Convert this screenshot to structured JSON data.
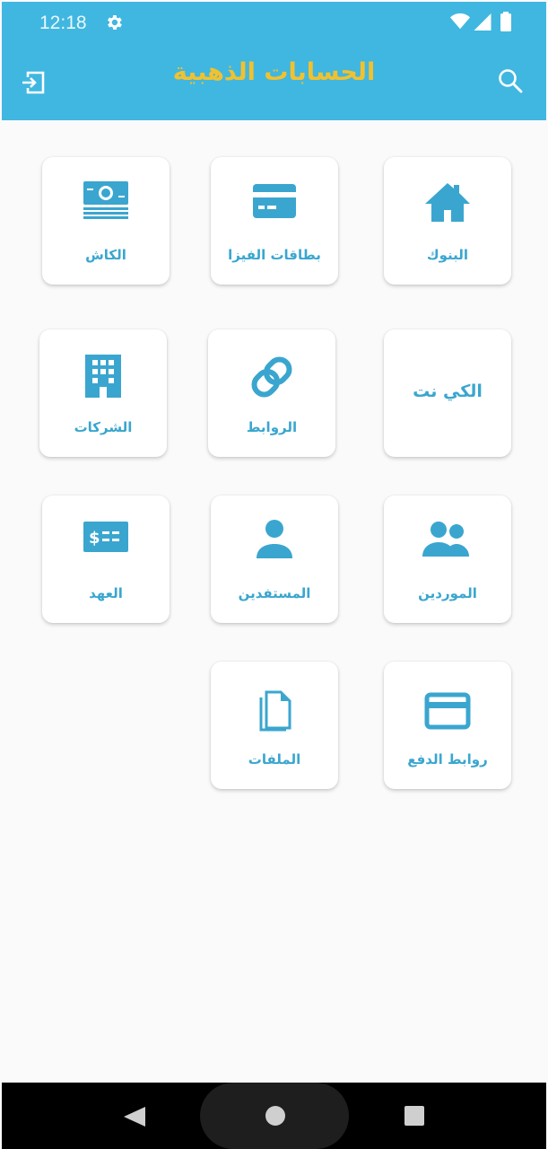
{
  "status_bar": {
    "time": "12:18"
  },
  "app_bar": {
    "title": "الحسابات الذهبية"
  },
  "colors": {
    "primary": "#40b7e0",
    "title": "#f2c12e",
    "icon": "#3aa6cf"
  },
  "tiles": [
    {
      "label": "البنوك",
      "icon": "home-icon"
    },
    {
      "label": "بطاقات الفيزا",
      "icon": "credit-card-icon"
    },
    {
      "label": "الكاش",
      "icon": "cash-icon"
    },
    {
      "label": "الكي نت",
      "icon": ""
    },
    {
      "label": "الروابط",
      "icon": "link-icon"
    },
    {
      "label": "الشركات",
      "icon": "building-icon"
    },
    {
      "label": "الموردين",
      "icon": "people-icon"
    },
    {
      "label": "المستفدين",
      "icon": "person-icon"
    },
    {
      "label": "العهد",
      "icon": "money-icon"
    },
    {
      "label": "روابط الدفع",
      "icon": "payment-card-icon"
    },
    {
      "label": "الملفات",
      "icon": "files-icon"
    }
  ]
}
